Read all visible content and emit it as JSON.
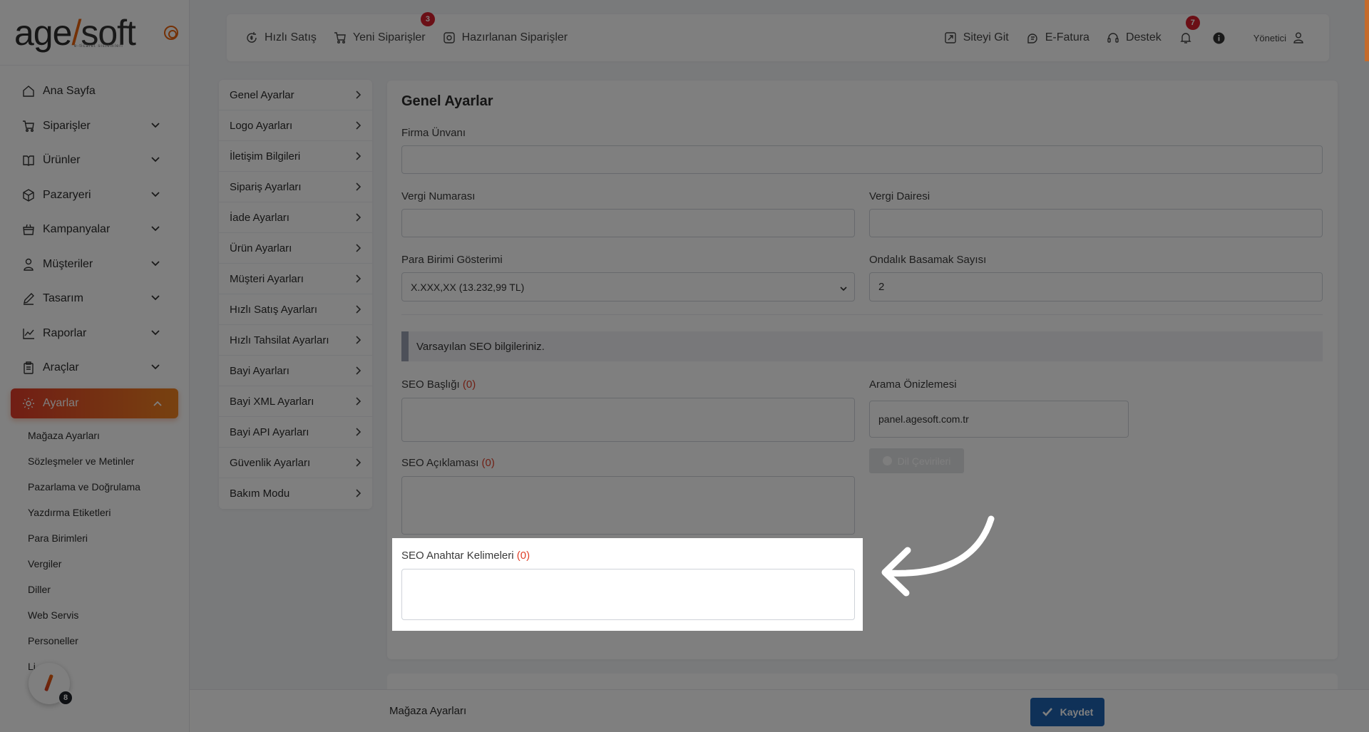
{
  "logo": {
    "brand_a": "age",
    "brand_b": "soft",
    "tagline": "e-ticaret sistemleri"
  },
  "sidebar": {
    "items": [
      {
        "label": "Ana Sayfa",
        "icon": "home-icon"
      },
      {
        "label": "Siparişler",
        "icon": "cart-icon"
      },
      {
        "label": "Ürünler",
        "icon": "book-icon"
      },
      {
        "label": "Pazaryeri",
        "icon": "box-icon"
      },
      {
        "label": "Kampanyalar",
        "icon": "basket-icon"
      },
      {
        "label": "Müşteriler",
        "icon": "user-icon"
      },
      {
        "label": "Tasarım",
        "icon": "edit-icon"
      },
      {
        "label": "Raporlar",
        "icon": "chart-icon"
      },
      {
        "label": "Araçlar",
        "icon": "clipboard-icon"
      },
      {
        "label": "Ayarlar",
        "icon": "gear-icon"
      }
    ],
    "sub_items": [
      "Mağaza Ayarları",
      "Sözleşmeler ve Metinler",
      "Pazarlama ve Doğrulama",
      "Yazdırma Etiketleri",
      "Para Birimleri",
      "Vergiler",
      "Diller",
      "Web Servis",
      "Personeller",
      "Li"
    ],
    "help_badge": "8"
  },
  "topbar": {
    "quick_sale": "Hızlı Satış",
    "new_orders": "Yeni Siparişler",
    "new_orders_badge": "3",
    "preparing_orders": "Hazırlanan Siparişler",
    "go_site": "Siteyi Git",
    "e_invoice": "E-Fatura",
    "support": "Destek",
    "notif_badge": "7",
    "user": "Yönetici"
  },
  "settings_menu": [
    "Genel Ayarlar",
    "Logo Ayarları",
    "İletişim Bilgileri",
    "Sipariş Ayarları",
    "İade Ayarları",
    "Ürün Ayarları",
    "Müşteri Ayarları",
    "Hızlı Satış Ayarları",
    "Hızlı Tahsilat Ayarları",
    "Bayi Ayarları",
    "Bayi XML Ayarları",
    "Bayi API Ayarları",
    "Güvenlik Ayarları",
    "Bakım Modu"
  ],
  "form": {
    "title": "Genel Ayarlar",
    "company_label": "Firma Ünvanı",
    "company_value": "",
    "tax_no_label": "Vergi Numarası",
    "tax_no_value": "",
    "tax_office_label": "Vergi Dairesi",
    "tax_office_value": "",
    "currency_label": "Para Birimi Gösterimi",
    "currency_value": "X.XXX,XX (13.232,99 TL)",
    "decimal_label": "Ondalık Basamak Sayısı",
    "decimal_value": "2",
    "seo_info": "Varsayılan SEO bilgileriniz.",
    "seo_title_label": "SEO Başlığı",
    "seo_title_count": "(0)",
    "seo_desc_label": "SEO Açıklaması",
    "seo_desc_count": "(0)",
    "seo_kw_label": "SEO Anahtar Kelimeleri",
    "seo_kw_count": "(0)",
    "preview_label": "Arama Önizlemesi",
    "preview_value": "panel.agesoft.com.tr",
    "lang_button": "Dil Çevirileri"
  },
  "bottom": {
    "title": "Mağaza Ayarları",
    "save": "Kaydet"
  }
}
